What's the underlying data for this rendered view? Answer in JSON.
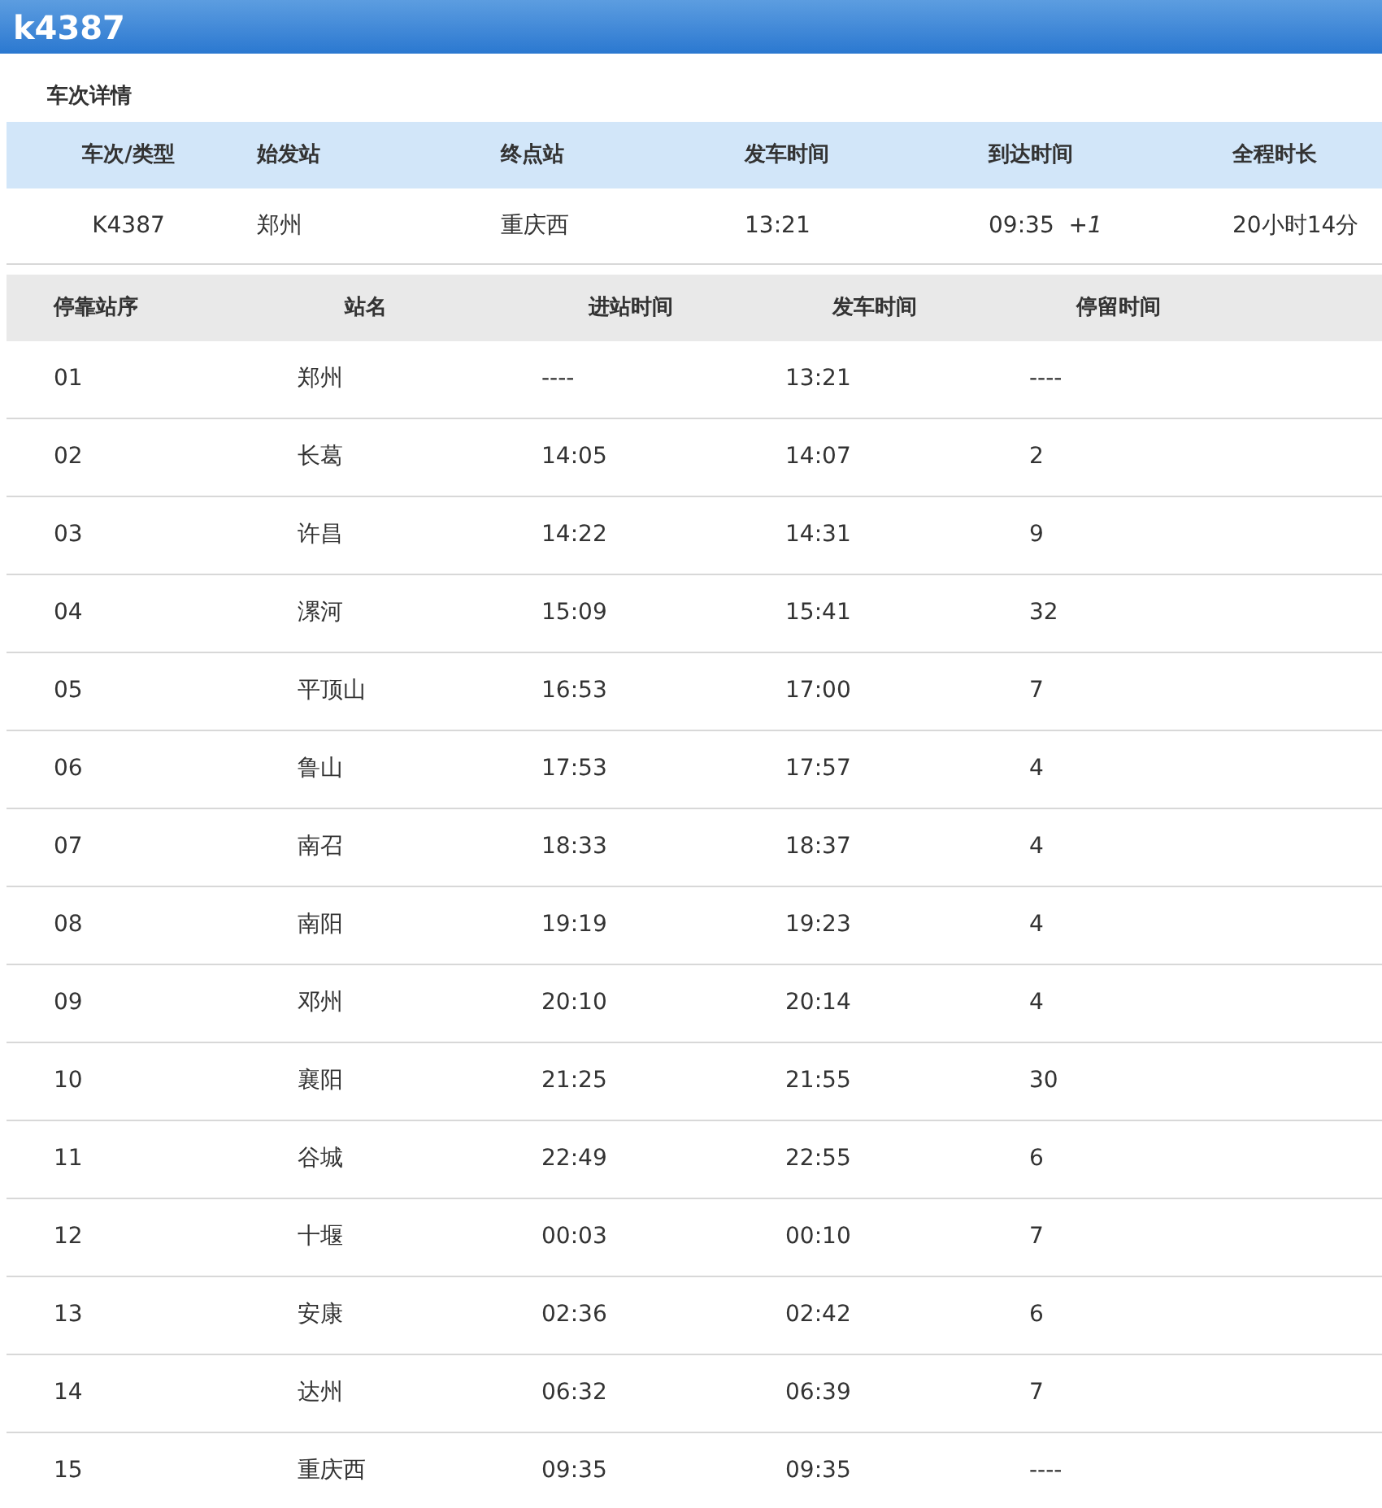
{
  "title": "k4387",
  "section_title": "车次详情",
  "summary": {
    "columns": [
      "车次/类型",
      "始发站",
      "终点站",
      "发车时间",
      "到达时间",
      "全程时长"
    ],
    "row": [
      "K4387",
      "郑州",
      "重庆西",
      "13:21",
      "09:35  *+1*",
      "20小时14分"
    ]
  },
  "stops": {
    "columns": [
      "停靠站序",
      "站名",
      "进站时间",
      "发车时间",
      "停留时间"
    ],
    "rows": [
      [
        "01",
        "郑州",
        "----",
        "13:21",
        "----"
      ],
      [
        "02",
        "长葛",
        "14:05",
        "14:07",
        "2"
      ],
      [
        "03",
        "许昌",
        "14:22",
        "14:31",
        "9"
      ],
      [
        "04",
        "漯河",
        "15:09",
        "15:41",
        "32"
      ],
      [
        "05",
        "平顶山",
        "16:53",
        "17:00",
        "7"
      ],
      [
        "06",
        "鲁山",
        "17:53",
        "17:57",
        "4"
      ],
      [
        "07",
        "南召",
        "18:33",
        "18:37",
        "4"
      ],
      [
        "08",
        "南阳",
        "19:19",
        "19:23",
        "4"
      ],
      [
        "09",
        "邓州",
        "20:10",
        "20:14",
        "4"
      ],
      [
        "10",
        "襄阳",
        "21:25",
        "21:55",
        "30"
      ],
      [
        "11",
        "谷城",
        "22:49",
        "22:55",
        "6"
      ],
      [
        "12",
        "十堰",
        "00:03",
        "00:10",
        "7"
      ],
      [
        "13",
        "安康",
        "02:36",
        "02:42",
        "6"
      ],
      [
        "14",
        "达州",
        "06:32",
        "06:39",
        "7"
      ],
      [
        "15",
        "重庆西",
        "09:35",
        "09:35",
        "----"
      ]
    ]
  }
}
